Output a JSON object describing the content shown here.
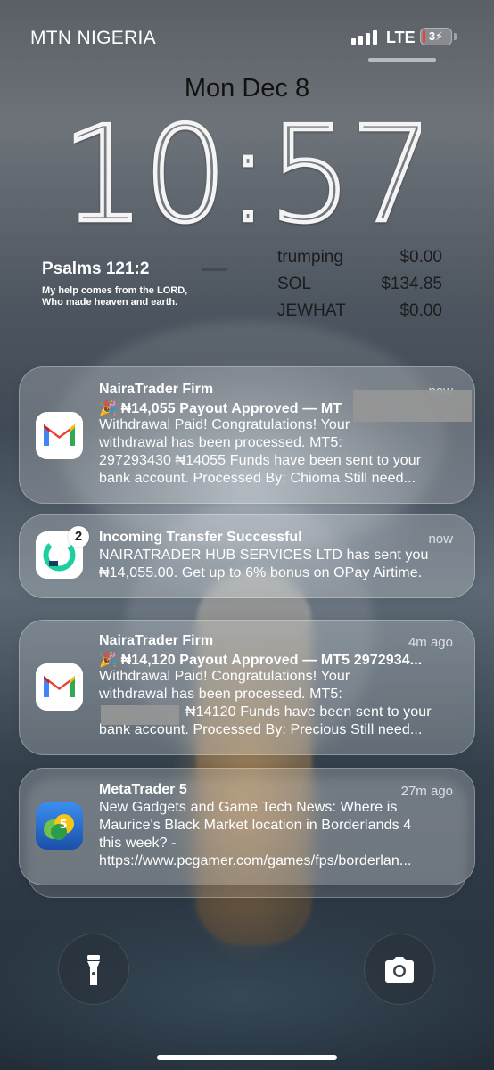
{
  "status_bar": {
    "carrier": "MTN NIGERIA",
    "network": "LTE",
    "battery": "3",
    "battery_charging_icon": "bolt-icon"
  },
  "lock_screen": {
    "date": "Mon Dec 8",
    "time": "10:57"
  },
  "widgets": {
    "verse": {
      "reference": "Psalms 121:2",
      "line1": "My help comes from the LORD,",
      "line2": "Who made heaven and earth."
    },
    "stocks": [
      {
        "symbol": "trumping",
        "price": "$0.00"
      },
      {
        "symbol": "SOL",
        "price": "$134.85"
      },
      {
        "symbol": "JEWHAT",
        "price": "$0.00"
      }
    ]
  },
  "notifications": [
    {
      "app": "gmail",
      "title": "NairaTrader Firm",
      "time": "now",
      "subject": "🎉 ₦14,055 Payout Approved — MT",
      "lines": [
        "Withdrawal Paid! Congratulations! Your",
        "withdrawal has been processed. MT5:",
        "297293430 ₦14055 Funds have been sent to your",
        "bank account. Processed By: Chioma Still need..."
      ]
    },
    {
      "app": "opay",
      "badge": "2",
      "title": "Incoming Transfer Successful",
      "time": "now",
      "lines": [
        "NAIRATRADER HUB SERVICES LTD has sent you",
        "₦14,055.00. Get up to 6% bonus on OPay Airtime."
      ]
    },
    {
      "app": "gmail",
      "title": "NairaTrader Firm",
      "time": "4m ago",
      "subject": "🎉 ₦14,120 Payout Approved — MT5 2972934...",
      "lines": [
        "Withdrawal Paid! Congratulations! Your",
        "withdrawal has been processed. MT5:",
        "₦14120 Funds have been sent to your",
        "bank account. Processed By: Precious Still need..."
      ]
    },
    {
      "app": "metatrader",
      "title": "MetaTrader 5",
      "time": "27m ago",
      "lines": [
        "New Gadgets and Game Tech News: Where is",
        "Maurice's Black Market location in Borderlands 4",
        "this week? -",
        "https://www.pcgamer.com/games/fps/borderlan..."
      ]
    }
  ],
  "bottom_buttons": {
    "left": "flashlight-icon",
    "right": "camera-icon"
  },
  "colors": {
    "gmail_red": "#ea4335",
    "gmail_blue": "#4285f4",
    "gmail_green": "#34a853",
    "gmail_yellow": "#fbbc04",
    "opay_teal": "#1dcf9f",
    "opay_dark": "#1d3a5f",
    "battery_red": "#ff3b30"
  }
}
